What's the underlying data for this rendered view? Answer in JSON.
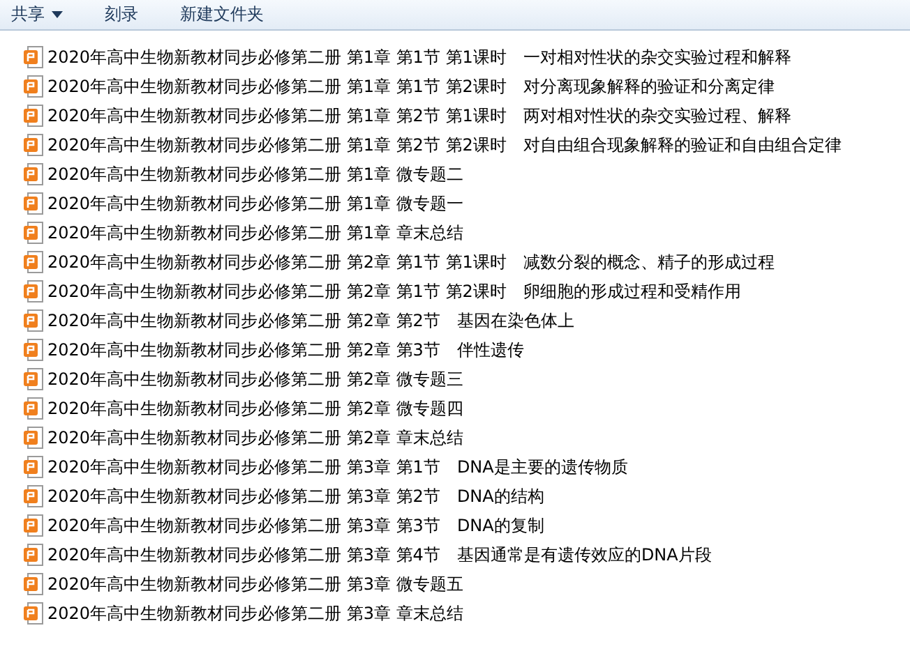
{
  "toolbar": {
    "items": [
      {
        "label": "共享",
        "dropdown": true
      },
      {
        "label": "刻录",
        "dropdown": false
      },
      {
        "label": "新建文件夹",
        "dropdown": false
      }
    ]
  },
  "files": [
    {
      "name": "2020年高中生物新教材同步必修第二册 第1章 第1节 第1课时　一对相对性状的杂交实验过程和解释"
    },
    {
      "name": "2020年高中生物新教材同步必修第二册 第1章 第1节 第2课时　对分离现象解释的验证和分离定律"
    },
    {
      "name": "2020年高中生物新教材同步必修第二册 第1章 第2节 第1课时　两对相对性状的杂交实验过程、解释"
    },
    {
      "name": "2020年高中生物新教材同步必修第二册 第1章 第2节 第2课时　对自由组合现象解释的验证和自由组合定律"
    },
    {
      "name": "2020年高中生物新教材同步必修第二册 第1章 微专题二"
    },
    {
      "name": "2020年高中生物新教材同步必修第二册 第1章 微专题一"
    },
    {
      "name": "2020年高中生物新教材同步必修第二册 第1章 章末总结"
    },
    {
      "name": "2020年高中生物新教材同步必修第二册 第2章 第1节 第1课时　减数分裂的概念、精子的形成过程"
    },
    {
      "name": "2020年高中生物新教材同步必修第二册 第2章 第1节 第2课时　卵细胞的形成过程和受精作用"
    },
    {
      "name": "2020年高中生物新教材同步必修第二册 第2章 第2节　基因在染色体上"
    },
    {
      "name": "2020年高中生物新教材同步必修第二册 第2章 第3节　伴性遗传"
    },
    {
      "name": "2020年高中生物新教材同步必修第二册 第2章 微专题三"
    },
    {
      "name": "2020年高中生物新教材同步必修第二册 第2章 微专题四"
    },
    {
      "name": "2020年高中生物新教材同步必修第二册 第2章 章末总结"
    },
    {
      "name": "2020年高中生物新教材同步必修第二册 第3章 第1节　DNA是主要的遗传物质"
    },
    {
      "name": "2020年高中生物新教材同步必修第二册 第3章 第2节　DNA的结构"
    },
    {
      "name": "2020年高中生物新教材同步必修第二册 第3章 第3节　DNA的复制"
    },
    {
      "name": "2020年高中生物新教材同步必修第二册 第3章 第4节　基因通常是有遗传效应的DNA片段"
    },
    {
      "name": "2020年高中生物新教材同步必修第二册 第3章 微专题五"
    },
    {
      "name": "2020年高中生物新教材同步必修第二册 第3章 章末总结"
    }
  ]
}
